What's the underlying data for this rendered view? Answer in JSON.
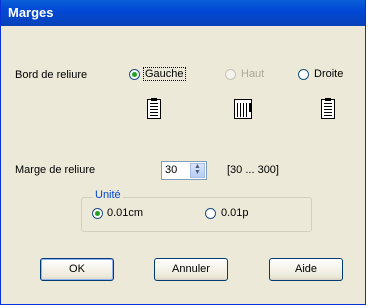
{
  "window": {
    "title": "Marges"
  },
  "binding_edge": {
    "label": "Bord de reliure",
    "options": [
      {
        "label": "Gauche",
        "accel": "G",
        "selected": true,
        "enabled": true
      },
      {
        "label": "Haut",
        "accel": "t",
        "selected": false,
        "enabled": false
      },
      {
        "label": "Droite",
        "accel": "D",
        "selected": false,
        "enabled": true
      }
    ],
    "icons": [
      "document-left-binding-icon",
      "document-top-binding-icon",
      "document-right-binding-icon"
    ]
  },
  "binding_margin": {
    "label": "Marge de reliure",
    "value": "30",
    "range": "[30 ... 300]"
  },
  "unit": {
    "label": "Unité",
    "options": [
      {
        "label": "0.01cm",
        "selected": true
      },
      {
        "label": "0.01p",
        "selected": false
      }
    ]
  },
  "buttons": {
    "ok": "OK",
    "cancel": "Annuler",
    "help": "Aide"
  }
}
